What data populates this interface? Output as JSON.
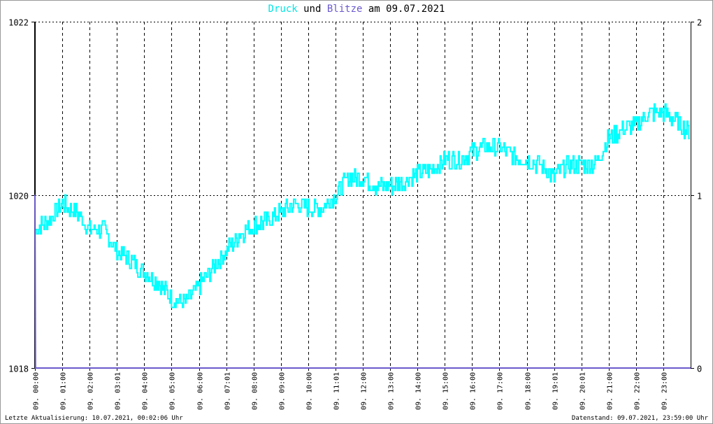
{
  "chart_data": {
    "type": "line",
    "title": {
      "part1": "Druck",
      "part2": " und ",
      "part3": "Blitze",
      "part4": " am 09.07.2021"
    },
    "y_left": {
      "ylim": [
        1018,
        1022
      ],
      "ticks": [
        "1018",
        "1020",
        "1022"
      ]
    },
    "y_right": {
      "ylim": [
        0,
        2
      ],
      "ticks": [
        "0",
        "1",
        "2"
      ]
    },
    "x_ticks": [
      "09. 00:00",
      "09. 01:00",
      "09. 02:00",
      "09. 03:01",
      "09. 04:00",
      "09. 05:00",
      "09. 06:00",
      "09. 07:01",
      "09. 08:00",
      "09. 09:00",
      "09. 10:00",
      "09. 11:01",
      "09. 12:00",
      "09. 13:00",
      "09. 14:00",
      "09. 15:00",
      "09. 16:00",
      "09. 17:00",
      "09. 18:00",
      "09. 19:01",
      "09. 20:01",
      "09. 21:00",
      "09. 22:00",
      "09. 23:00"
    ],
    "xlim_hours": [
      0,
      24
    ],
    "grid": true,
    "series": [
      {
        "name": "Druck",
        "axis": "left",
        "color": "#00ffff",
        "step_hours": 0.5,
        "values": [
          1019.6,
          1019.7,
          1019.9,
          1019.8,
          1019.6,
          1019.6,
          1019.35,
          1019.25,
          1019.1,
          1019.0,
          1018.8,
          1018.75,
          1018.95,
          1019.15,
          1019.35,
          1019.55,
          1019.65,
          1019.7,
          1019.8,
          1019.9,
          1019.85,
          1019.85,
          1020.0,
          1020.2,
          1020.2,
          1020.1,
          1020.1,
          1020.15,
          1020.25,
          1020.3,
          1020.4,
          1020.4,
          1020.5,
          1020.55,
          1020.55,
          1020.45,
          1020.4,
          1020.35,
          1020.2,
          1020.35,
          1020.35,
          1020.35,
          1020.65,
          1020.75,
          1020.8,
          1020.95,
          1020.95,
          1020.85,
          1020.7
        ]
      },
      {
        "name": "Blitze",
        "axis": "right",
        "color": "#6a5acd",
        "values": [
          {
            "hour": 0,
            "value": 1
          },
          {
            "hour": 0.02,
            "value": 0
          },
          {
            "hour": 24,
            "value": 0
          }
        ]
      }
    ]
  },
  "footer": {
    "left": "Letzte Aktualisierung: 10.07.2021, 00:02:06 Uhr",
    "right": "Datenstand: 09.07.2021, 23:59:00 Uhr"
  }
}
